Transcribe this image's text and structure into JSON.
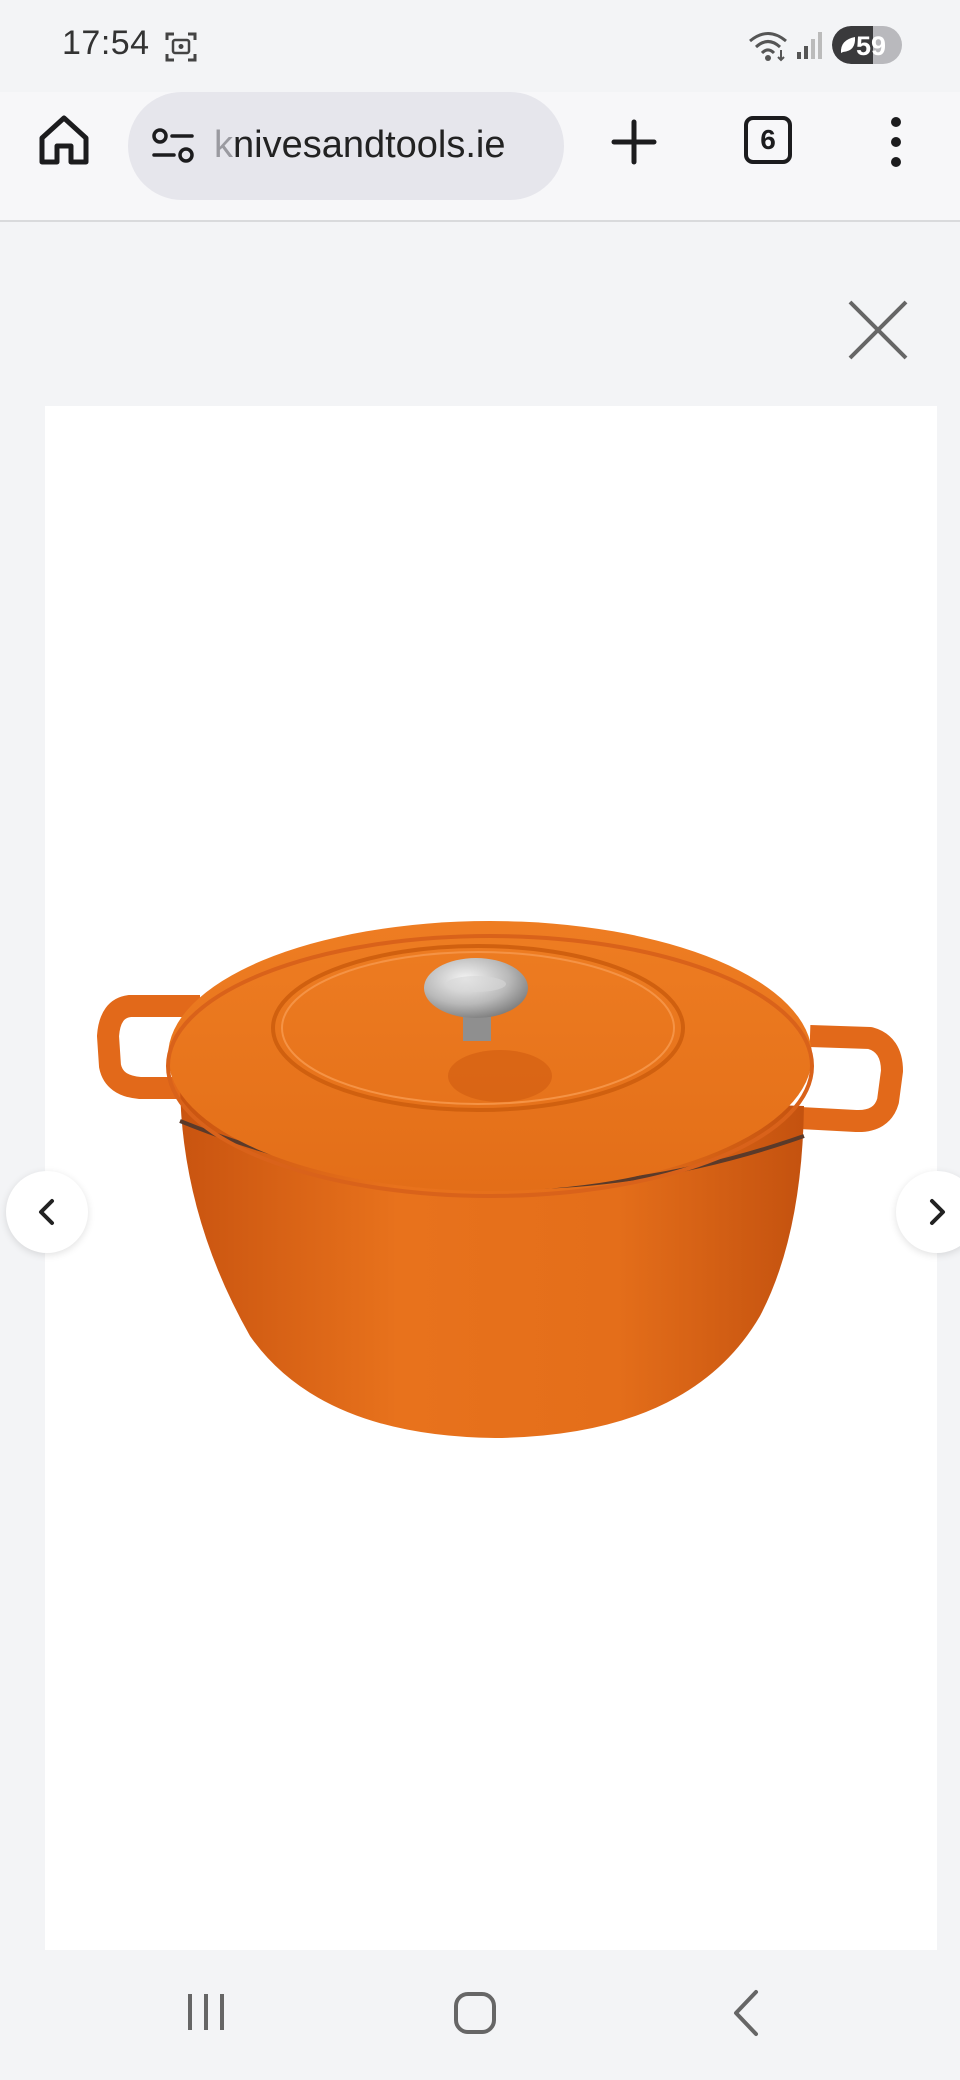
{
  "status_bar": {
    "time": "17:54",
    "battery_level": "59",
    "battery_fraction": 0.59
  },
  "browser": {
    "url_fade": "k",
    "url_rest": "nivesandtools.ie",
    "tab_count": "6"
  },
  "viewer": {
    "product_image": "orange-cast-iron-casserole-pot",
    "accent_color": "#e67019"
  }
}
